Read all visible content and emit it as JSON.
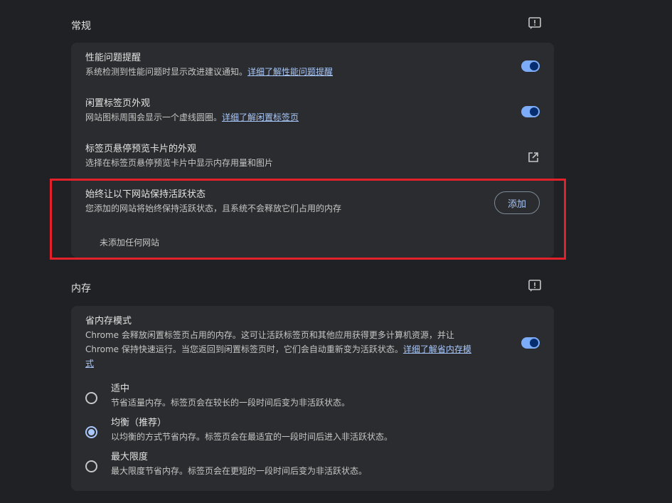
{
  "general": {
    "title": "常规",
    "feedback_icon": "feedback-icon",
    "performance": {
      "title": "性能问题提醒",
      "desc": "系统检测到性能问题时显示改进建议通知。",
      "link": "详细了解性能问题提醒",
      "enabled": true
    },
    "inactive_tabs": {
      "title": "闲置标签页外观",
      "desc": "网站图标周围会显示一个虚线圆圈。",
      "link": "详细了解闲置标签页",
      "enabled": true
    },
    "hover_card": {
      "title": "标签页悬停预览卡片的外观",
      "desc": "选择在标签页悬停预览卡片中显示内存用量和图片",
      "icon": "open-in-new-icon"
    },
    "always_active": {
      "title": "始终让以下网站保持活跃状态",
      "desc": "您添加的网站将始终保持活跃状态，且系统不会释放它们占用的内存",
      "add_label": "添加",
      "empty": "未添加任何网站"
    }
  },
  "memory": {
    "title": "内存",
    "feedback_icon": "feedback-icon",
    "saver": {
      "title": "省内存模式",
      "desc_line1": "Chrome 会释放闲置标签页占用的内存。这可让活跃标签页和其他应用获得更多计算机资源，并让",
      "desc_line2": "Chrome 保持快速运行。当您返回到闲置标签页时，它们会自动重新变为活跃状态。",
      "link_part1": "详细了解省内存模",
      "link_part2": "式",
      "enabled": true
    },
    "options": [
      {
        "label": "适中",
        "desc": "节省适量内存。标签页会在较长的一段时间后变为非活跃状态。",
        "checked": false
      },
      {
        "label": "均衡（推荐）",
        "desc": "以均衡的方式节省内存。标签页会在最适宜的一段时间后进入非活跃状态。",
        "checked": true
      },
      {
        "label": "最大限度",
        "desc": "最大限度节省内存。标签页会在更短的一段时间后变为非活跃状态。",
        "checked": false
      }
    ]
  },
  "colors": {
    "accent": "#a8c7fa",
    "highlight_box": "#e4212a",
    "card_bg": "#2b2c2f",
    "page_bg": "#202124"
  }
}
